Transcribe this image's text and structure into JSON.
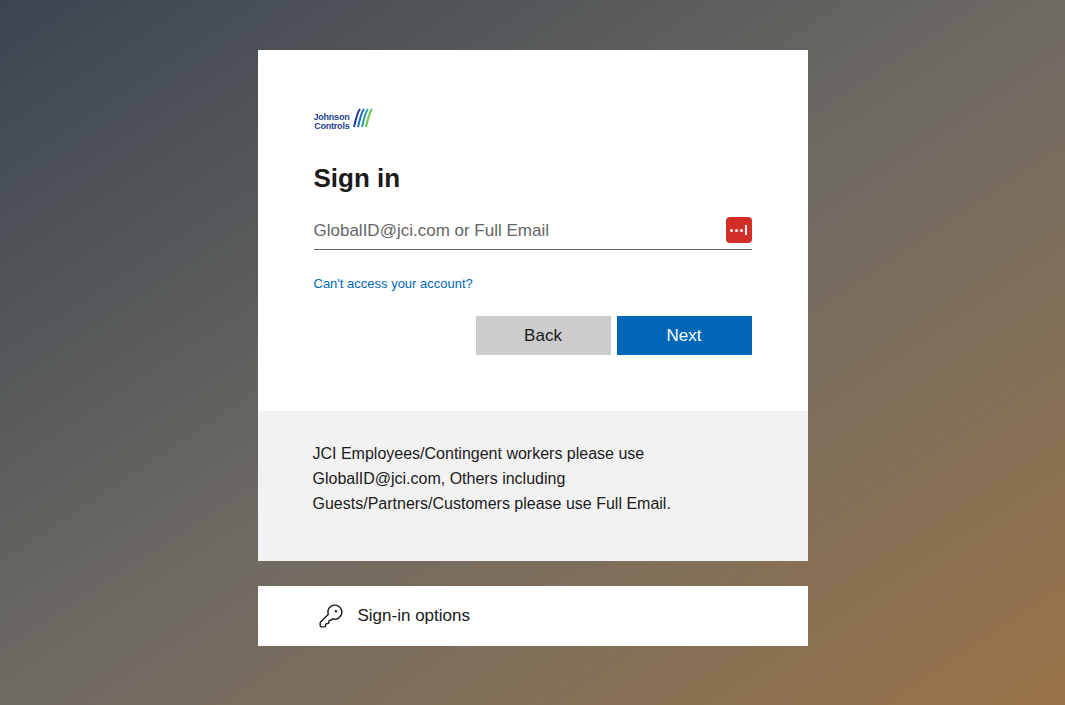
{
  "logo": {
    "lines": [
      "Johnson",
      "Controls"
    ]
  },
  "title": "Sign in",
  "field": {
    "placeholder": "GlobalID@jci.com or Full Email",
    "value": ""
  },
  "link": "Can't access your account?",
  "buttons": [
    {
      "label": "Back",
      "kind": "secondary"
    },
    {
      "label": "Next",
      "kind": "primary"
    }
  ],
  "notice": {
    "lines": [
      "JCI Employees/Contingent workers please use",
      "GlobalID@jci.com, Others including",
      "Guests/Partners/Customers please use Full Email."
    ]
  },
  "sign_in_options": "Sign-in options"
}
